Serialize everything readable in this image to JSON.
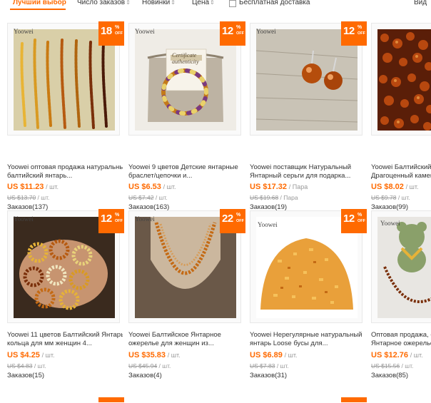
{
  "sort_bar": {
    "best_match": "Лучший выбор",
    "orders": "Число заказов",
    "newest": "Новинки",
    "price": "Цена",
    "free_shipping": "Бесплатная доставка",
    "view": "Вид",
    "arrow_glyph": "⇕"
  },
  "products": [
    {
      "badge_num": "18",
      "badge_pct": "%",
      "badge_off": "OFF",
      "brand": "Yoowei",
      "title_line1": "Yoowei оптовая продажа натуральный",
      "title_line2": "балтийский янтарь...",
      "price": "US $11.23",
      "unit": "/ шт.",
      "old_price": "US $13.70",
      "old_unit": " / шт.",
      "orders": "Заказов(137)"
    },
    {
      "badge_num": "12",
      "badge_pct": "%",
      "badge_off": "OFF",
      "brand": "Yoowei",
      "title_line1": "Yoowei 9 цветов Детские янтарные",
      "title_line2": "браслет/цепочки и...",
      "price": "US $6.53",
      "unit": "/ шт.",
      "old_price": "US $7.42",
      "old_unit": " / шт.",
      "orders": "Заказов(163)",
      "cert_title": "Certificate authenticity"
    },
    {
      "badge_num": "12",
      "badge_pct": "%",
      "badge_off": "OFF",
      "brand": "Yoowei",
      "title_line1": "Yoowei поставщик Натуральный",
      "title_line2": "Янтарный серьги для подарка...",
      "price": "US $17.32",
      "unit": "/ Пара",
      "old_price": "US $19.68",
      "old_unit": " / Пара",
      "orders": "Заказов(19)"
    },
    {
      "badge_num": "",
      "badge_pct": "",
      "badge_off": "",
      "brand": "",
      "title_line1": "Yoowei Балтийский Янт",
      "title_line2": "Драгоценный камен",
      "price": "US $8.02",
      "unit": "/ шт.",
      "old_price": "US $9.78",
      "old_unit": " / шт.",
      "orders": "Заказов(99)"
    },
    {
      "badge_num": "12",
      "badge_pct": "%",
      "badge_off": "OFF",
      "brand": "Yoowei",
      "title_line1": "Yoowei 11 цветов Балтийский Янтарь",
      "title_line2": "кольца для мм женщин 4...",
      "price": "US $4.25",
      "unit": "/ шт.",
      "old_price": "US $4.83",
      "old_unit": " / шт.",
      "orders": "Заказов(15)"
    },
    {
      "badge_num": "22",
      "badge_pct": "%",
      "badge_off": "OFF",
      "brand": "Yoowei",
      "title_line1": "Yoowei Балтийское Янтарное",
      "title_line2": "ожерелье для женщин из...",
      "price": "US $35.83",
      "unit": "/ шт.",
      "old_price": "US $45.94",
      "old_unit": " / шт.",
      "orders": "Заказов(4)"
    },
    {
      "badge_num": "12",
      "badge_pct": "%",
      "badge_off": "OFF",
      "brand": "Yoowei",
      "title_line1": "Yoowei Нерегулярные натуральный",
      "title_line2": "янтарь Loose бусы для...",
      "price": "US $6.89",
      "unit": "/ шт.",
      "old_price": "US $7.83",
      "old_unit": " / шт.",
      "orders": "Заказов(31)"
    },
    {
      "badge_num": "",
      "badge_pct": "",
      "badge_off": "",
      "brand": "Yoowei",
      "title_line1": "Оптовая продажа, о",
      "title_line2": "Янтарное ожерелье",
      "price": "US $12.76",
      "unit": "/ шт.",
      "old_price": "US $15.56",
      "old_unit": " / шт.",
      "orders": "Заказов(85)"
    }
  ],
  "colors": {
    "accent": "#ff6a00",
    "muted": "#999999",
    "amber_dark": "#7a2f0a",
    "amber": "#c46a14",
    "amber_light": "#e8a53a"
  }
}
